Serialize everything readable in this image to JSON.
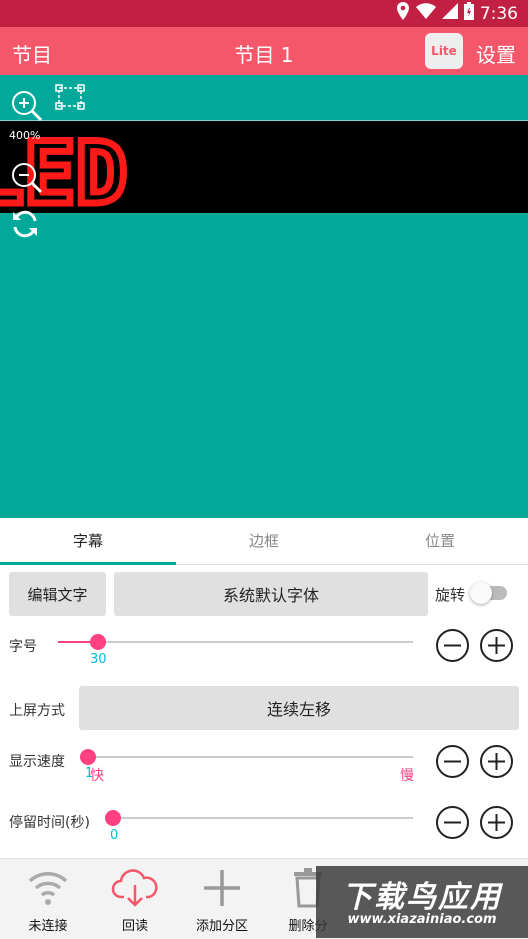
{
  "status_bar": {
    "time": "7:36"
  },
  "title_bar": {
    "left": "节目",
    "title": "节目 1",
    "badge": "Lite",
    "settings": "设置"
  },
  "preview": {
    "zoom": "400%",
    "led_text": "LED"
  },
  "tabs": [
    "字幕",
    "边框",
    "位置"
  ],
  "controls": {
    "edit_text": "编辑文字",
    "font": "系统默认字体",
    "rotate": "旋转",
    "font_size_label": "字号",
    "font_size_value": "30",
    "entry_label": "上屏方式",
    "entry_value": "连续左移",
    "speed_label": "显示速度",
    "speed_value": "1",
    "speed_fast": "快",
    "speed_slow": "慢",
    "stay_label": "停留时间(秒)",
    "stay_value": "0"
  },
  "bottom_nav": [
    "未连接",
    "回读",
    "添加分区",
    "删除分"
  ],
  "watermark": {
    "title": "下载鸟应用",
    "url": "www.xiazainiao.com"
  },
  "colors": {
    "status": "#c22043",
    "title": "#f4576a",
    "canvas": "#00a99a",
    "accent": "#ff4081",
    "value": "#00bcd4"
  }
}
